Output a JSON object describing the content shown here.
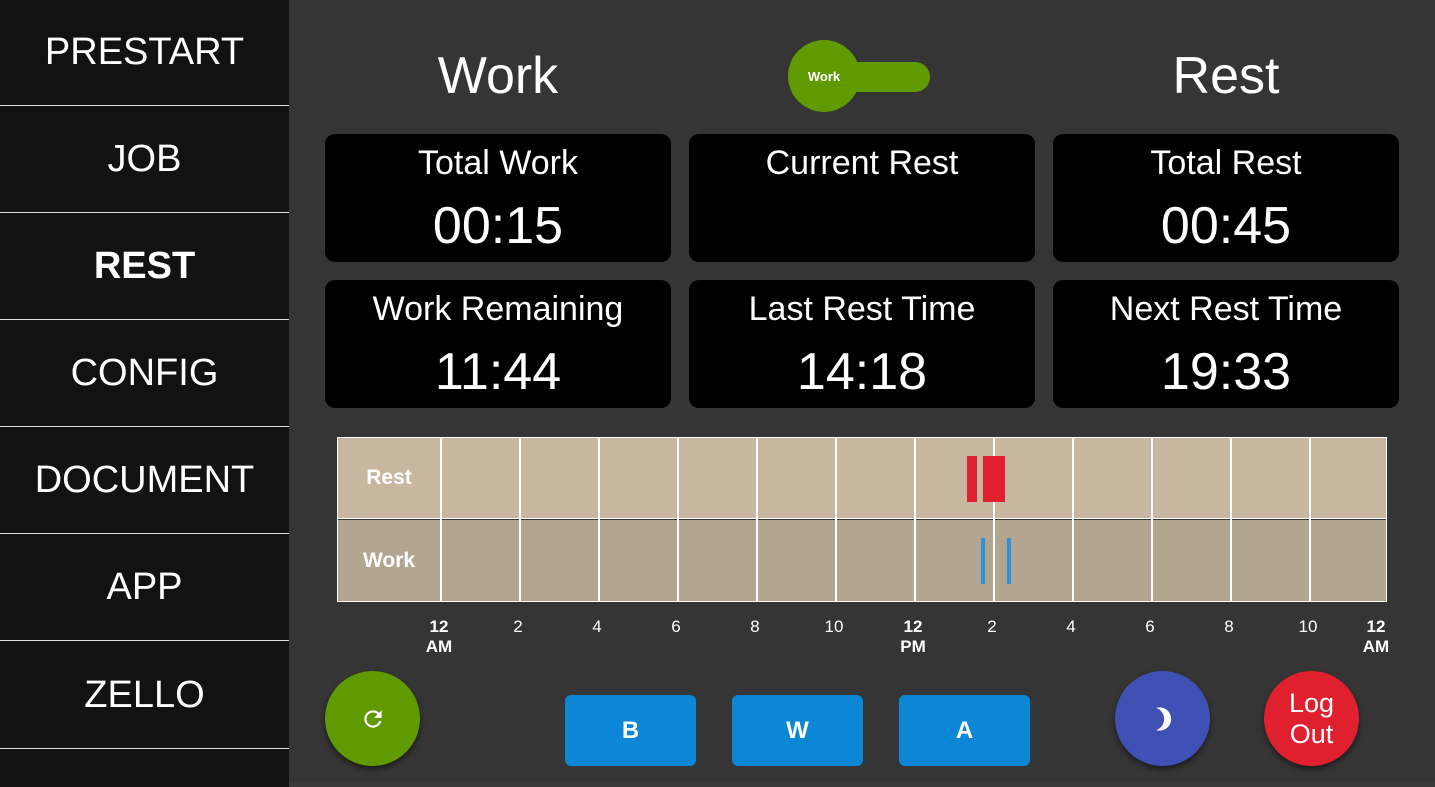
{
  "sidebar": {
    "items": [
      {
        "label": "PRESTART",
        "active": false
      },
      {
        "label": "JOB",
        "active": false
      },
      {
        "label": "REST",
        "active": true
      },
      {
        "label": "CONFIG",
        "active": false
      },
      {
        "label": "DOCUMENT",
        "active": false
      },
      {
        "label": "APP",
        "active": false
      },
      {
        "label": "ZELLO",
        "active": false
      }
    ]
  },
  "header": {
    "work_label": "Work",
    "rest_label": "Rest",
    "toggle_label": "Work"
  },
  "stats": {
    "total_work": {
      "label": "Total Work",
      "value": "00:15"
    },
    "current_rest": {
      "label": "Current Rest",
      "value": ""
    },
    "total_rest": {
      "label": "Total Rest",
      "value": "00:45"
    },
    "work_remaining": {
      "label": "Work Remaining",
      "value": "11:44"
    },
    "last_rest_time": {
      "label": "Last Rest Time",
      "value": "14:18"
    },
    "next_rest_time": {
      "label": "Next Rest Time",
      "value": "19:33"
    }
  },
  "timeline": {
    "rows": {
      "rest": "Rest",
      "work": "Work"
    },
    "ticks": [
      {
        "l1": "12",
        "l2": "AM"
      },
      {
        "l1": "2",
        "l2": ""
      },
      {
        "l1": "4",
        "l2": ""
      },
      {
        "l1": "6",
        "l2": ""
      },
      {
        "l1": "8",
        "l2": ""
      },
      {
        "l1": "10",
        "l2": ""
      },
      {
        "l1": "12",
        "l2": "PM"
      },
      {
        "l1": "2",
        "l2": ""
      },
      {
        "l1": "4",
        "l2": ""
      },
      {
        "l1": "6",
        "l2": ""
      },
      {
        "l1": "8",
        "l2": ""
      },
      {
        "l1": "10",
        "l2": ""
      },
      {
        "l1": "12",
        "l2": "AM"
      }
    ],
    "rest_periods_hours": [
      [
        13.35,
        13.6
      ],
      [
        13.75,
        14.3
      ]
    ],
    "work_periods_hours": [
      [
        13.7,
        13.8
      ],
      [
        14.35,
        14.45
      ]
    ],
    "rest_color": "#e0202e",
    "work_color": "#2f8fd8"
  },
  "buttons": {
    "refresh_icon": "refresh-icon",
    "b_label": "B",
    "w_label": "W",
    "a_label": "A",
    "night_icon": "moon-icon",
    "logout_line1": "Log",
    "logout_line2": "Out"
  },
  "colors": {
    "green": "#5f9a00",
    "blue": "#0b87d6",
    "indigo": "#3f51b5",
    "red": "#e0202e"
  }
}
